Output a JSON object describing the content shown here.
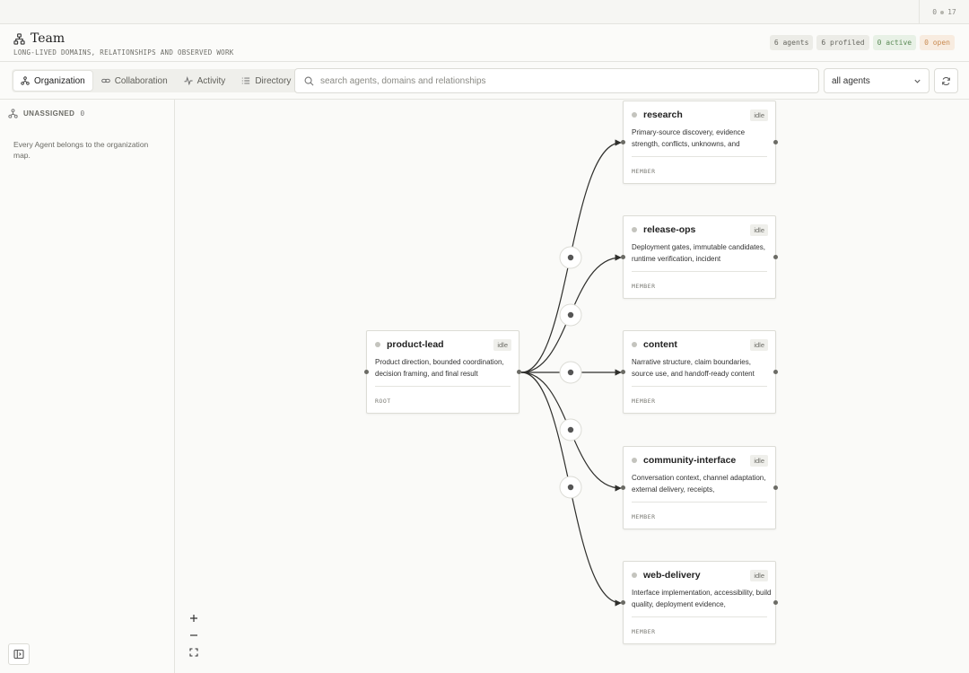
{
  "topbar": {
    "counter_left": "0",
    "counter_right": "17"
  },
  "header": {
    "title": "Team",
    "subtitle": "LONG-LIVED DOMAINS, RELATIONSHIPS AND OBSERVED WORK",
    "badges": {
      "agents": "6 agents",
      "profiled": "6 profiled",
      "active": "0 active",
      "open": "0 open"
    }
  },
  "toolbar": {
    "tabs": [
      "Organization",
      "Collaboration",
      "Activity",
      "Directory"
    ],
    "selected_tab": "Organization",
    "search_placeholder": "search agents, domains and relationships",
    "filter_value": "all agents"
  },
  "sidebar": {
    "heading": "UNASSIGNED",
    "count": "0",
    "note": "Every Agent belongs to the organization map."
  },
  "nodes": {
    "root": {
      "name": "product-lead",
      "status": "idle",
      "desc": "Product direction, bounded coordination, decision framing, and final result",
      "role": "ROOT"
    },
    "members": [
      {
        "name": "research",
        "status": "idle",
        "desc": "Primary-source discovery, evidence strength, conflicts, unknowns, and",
        "role": "MEMBER"
      },
      {
        "name": "release-ops",
        "status": "idle",
        "desc": "Deployment gates, immutable candidates, runtime verification, incident",
        "role": "MEMBER"
      },
      {
        "name": "content",
        "status": "idle",
        "desc": "Narrative structure, claim boundaries, source use, and handoff-ready content",
        "role": "MEMBER"
      },
      {
        "name": "community-interface",
        "status": "idle",
        "desc": "Conversation context, channel adaptation, external delivery, receipts,",
        "role": "MEMBER"
      },
      {
        "name": "web-delivery",
        "status": "idle",
        "desc": "Interface implementation, accessibility, build quality, deployment evidence,",
        "role": "MEMBER"
      }
    ]
  },
  "colors": {
    "edge": "#2f2f2c",
    "accent_active": "#5b8a56",
    "accent_open": "#c98a50"
  },
  "icons": {
    "title": "org-chart-icon",
    "tabs": [
      "org-chart-icon",
      "link-icon",
      "activity-icon",
      "list-icon"
    ],
    "search": "search-icon",
    "select": "chevron-down-icon",
    "refresh": "refresh-icon",
    "sidebar_toggle": "sidebar-toggle-icon",
    "zoom": [
      "plus-icon",
      "minus-icon",
      "fit-view-icon"
    ]
  }
}
